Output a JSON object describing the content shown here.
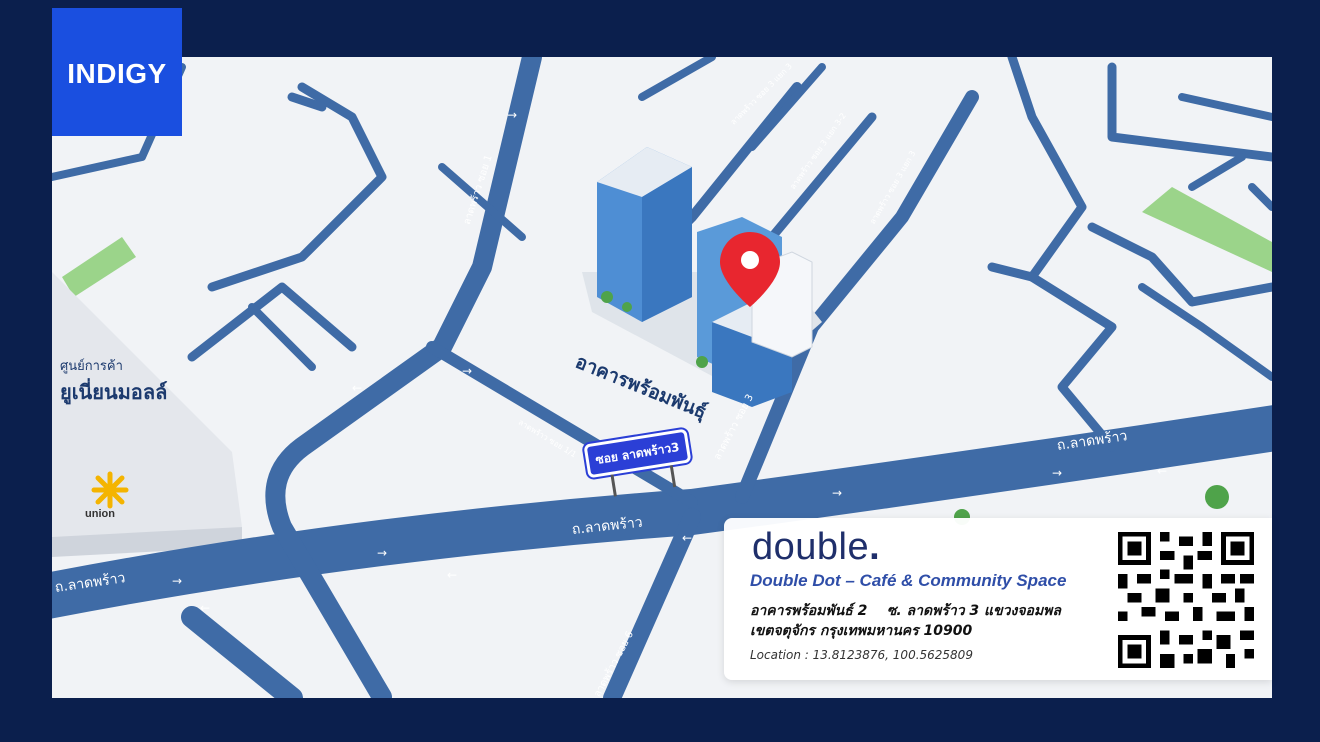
{
  "brand": {
    "label": "INDIGY"
  },
  "building": {
    "label": "อาคารพร้อมพันธุ์"
  },
  "mall": {
    "subtitle": "ศูนย์การค้า",
    "name": "ยูเนี่ยนมอลล์",
    "logo_text": "union"
  },
  "roads": {
    "main_left": "ถ.ลาดพร้าว",
    "main_center": "ถ.ลาดพร้าว",
    "main_right": "ถ.ลาดพร้าว",
    "soi1": "ลาดพร้าว ซอย 1",
    "soi1_1": "ลาดพร้าว ซอย 1/1",
    "soi3": "ลาดพร้าว ซอย 3",
    "soi3_3": "ลาดพร้าว ซอย 3 แยก 3",
    "soi3_2": "ลาดพร้าว ซอย 3 แยก 3-2",
    "soi3_top": "ลาดพร้าว ซอย 3 แยก 3",
    "soi6": "ลาดพร้าว ซอย 6"
  },
  "sign": {
    "label": "ซอย ลาดพร้าว3"
  },
  "card": {
    "logo": "double",
    "logo_dot": ".",
    "cafe_name": "Double Dot – Café & Community Space",
    "address_line1": "อาคารพร้อมพันธ์ 2    ซ. ลาดพร้าว 3 แขวงจอมพล",
    "address_line2": "เขตจตุจักร กรุงเทพมหานคร 10900",
    "location": "Location : 13.8123876, 100.5625809"
  },
  "colors": {
    "road": "#3f6ba6",
    "road_edge": "#2b5590",
    "background": "#0b1f4d",
    "brand": "#1a4fe0",
    "pin": "#e8262f",
    "sign": "#2b3fd6",
    "park": "#9bd48a"
  },
  "icons": {
    "pin": "map-pin-icon",
    "qr": "qr-code-icon"
  }
}
